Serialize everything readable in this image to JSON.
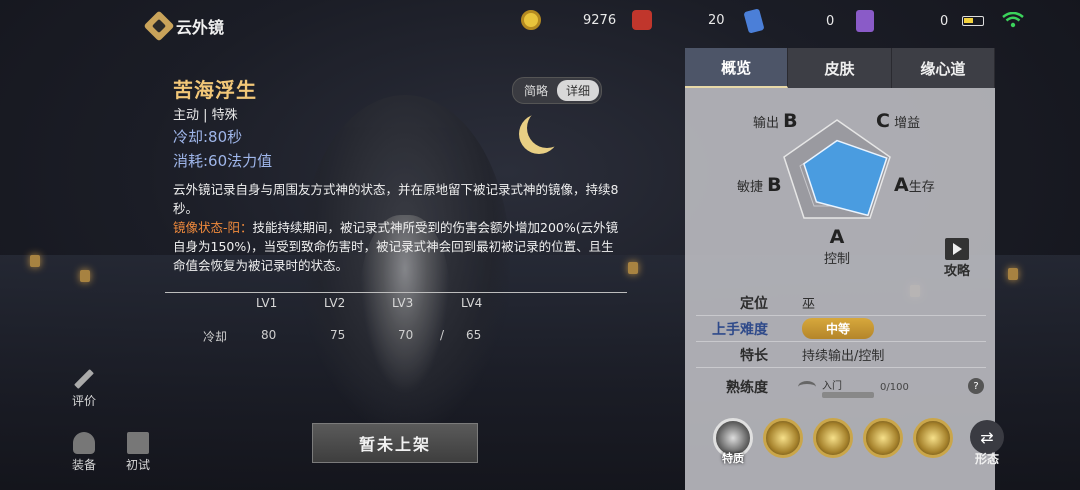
{
  "header": {
    "title": "云外镜",
    "coins": "9276",
    "jade": "20",
    "tickets": "0",
    "cards": "0"
  },
  "skill": {
    "name": "苦海浮生",
    "type": "主动 | 特殊",
    "cooldown": "冷却:80秒",
    "cost": "消耗:60法力值",
    "desc_1": "云外镜记录自身与周围友方式神的状态，并在原地留下被记录式神的镜像，持续8秒。",
    "mirror_label": "镜像状态-阳：",
    "desc_2": "技能持续期间，被记录式神所受到的伤害会额外增加200%(云外镜自身为150%)，当受到致命伤害时，被记录式神会回到最初被记录的位置、且生命值会恢复为被记录时的状态。",
    "levels": [
      "LV1",
      "LV2",
      "LV3",
      "LV4"
    ],
    "cd_label": "冷却",
    "cd_values": [
      "80",
      "75",
      "70",
      "65"
    ],
    "cd_sep": "/"
  },
  "mode_toggle": {
    "brief": "简略",
    "detail": "详细"
  },
  "left_buttons": {
    "review": "评价",
    "equip": "装备",
    "trial": "初试"
  },
  "not_listed": "暂未上架",
  "tabs": [
    "概览",
    "皮肤",
    "缘心道"
  ],
  "radar": {
    "output": {
      "label": "输出",
      "grade": "B"
    },
    "support": {
      "grade": "C",
      "label": "增益"
    },
    "agility": {
      "label": "敏捷",
      "grade": "B"
    },
    "survival": {
      "grade": "A",
      "label": "生存"
    },
    "control": {
      "grade": "A",
      "label": "控制"
    },
    "values": {
      "output": 0.5,
      "support": 0.5,
      "survival": 0.75,
      "control": 0.75,
      "agility": 0.5
    }
  },
  "guide_label": "攻略",
  "info": {
    "position_label": "定位",
    "position_value": "巫",
    "difficulty_label": "上手难度",
    "difficulty_value": "中等",
    "specialty_label": "特长",
    "specialty_value": "持续输出/控制",
    "proficiency_label": "熟练度",
    "proficiency_level": "入门",
    "proficiency_count": "0/100",
    "help": "?"
  },
  "bottom": {
    "trait_label": "特质",
    "form_label": "形态"
  },
  "colors": {
    "skill_name": "#f2c778",
    "stat": "#9fb6ea",
    "mirror": "#f08a3c",
    "badge": "#c99a38"
  }
}
